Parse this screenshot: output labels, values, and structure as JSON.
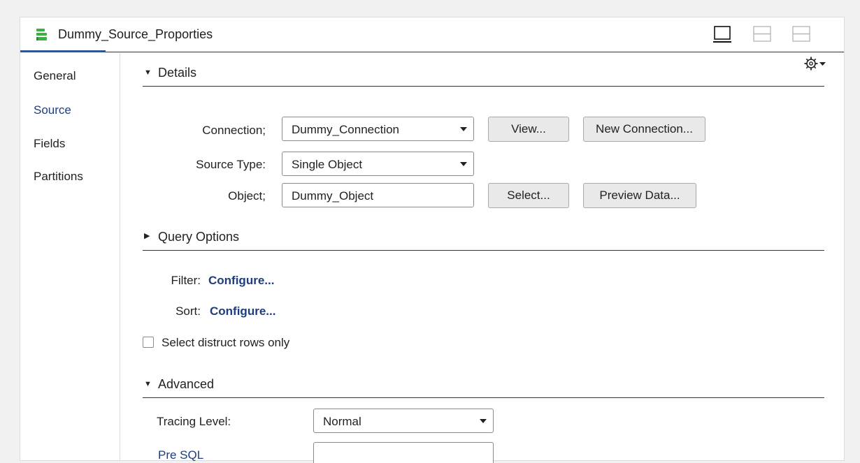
{
  "window": {
    "title": "Dummy_Source_Proporties",
    "icon": "source-transform-icon",
    "accent_color": "#2f5597",
    "icon_color": "#3cb043"
  },
  "sidebar": {
    "items": [
      {
        "label": "General",
        "active": false
      },
      {
        "label": "Source",
        "active": true
      },
      {
        "label": "Fields",
        "active": false
      },
      {
        "label": "Partitions",
        "active": false
      }
    ]
  },
  "details": {
    "header": "Details",
    "expanded": true,
    "connection_label": "Connection;",
    "connection_value": "Dummy_Connection",
    "view_button": "View...",
    "new_connection_button": "New Connection...",
    "source_type_label": "Source Type:",
    "source_type_value": "Single Object",
    "object_label": "Object;",
    "object_value": "Dummy_Object",
    "select_button": "Select...",
    "preview_button": "Preview Data..."
  },
  "query_options": {
    "header": "Query Options",
    "expanded": false,
    "filter_label": "Filter:",
    "filter_link": "Configure...",
    "sort_label": "Sort:",
    "sort_link": "Configure...",
    "distinct_label": "Select distruct rows only",
    "distinct_checked": false
  },
  "advanced": {
    "header": "Advanced",
    "expanded": true,
    "tracing_label": "Tracing Level:",
    "tracing_value": "Normal",
    "pre_sql_label": "Pre SQL",
    "pre_sql_value": ""
  }
}
